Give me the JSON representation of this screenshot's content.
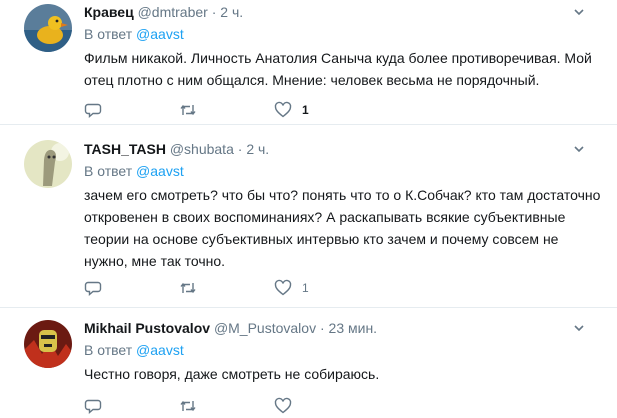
{
  "tweets": [
    {
      "fullname": "Кравец",
      "username": "@dmtraber",
      "separator": "·",
      "time": "2 ч.",
      "reply_prefix": "В ответ",
      "reply_handle": "@aavst",
      "text": "Фильм никакой. Личность Анатолия Саныча куда более противоречивая. Мой отец плотно с ним общался. Мнение: человек весьма не порядочный.",
      "like_count": "1"
    },
    {
      "fullname": "TASH_TASH",
      "username": "@shubata",
      "separator": "·",
      "time": "2 ч.",
      "reply_prefix": "В ответ",
      "reply_handle": "@aavst",
      "text": "зачем его смотреть? что бы что? понять что то о К.Собчак? кто там достаточно откровенен в своих воспоминаниях? А раскапывать всякие субъективные теории на основе субъективных интервью кто зачем и почему совсем не нужно, мне так точно.",
      "like_count": "1"
    },
    {
      "fullname": "Mikhail Pustovalov",
      "username": "@M_Pustovalov",
      "separator": "·",
      "time": "23 мин.",
      "reply_prefix": "В ответ",
      "reply_handle": "@aavst",
      "text": "Честно говоря, даже смотреть не собираюсь.",
      "like_count": ""
    }
  ],
  "icons": {
    "reply": "reply-icon",
    "retweet": "retweet-icon",
    "like": "heart-icon",
    "menu": "chevron-down-icon"
  },
  "colors": {
    "link": "#1da1f2",
    "secondary_text": "#657786",
    "divider": "#e6ecf0"
  }
}
